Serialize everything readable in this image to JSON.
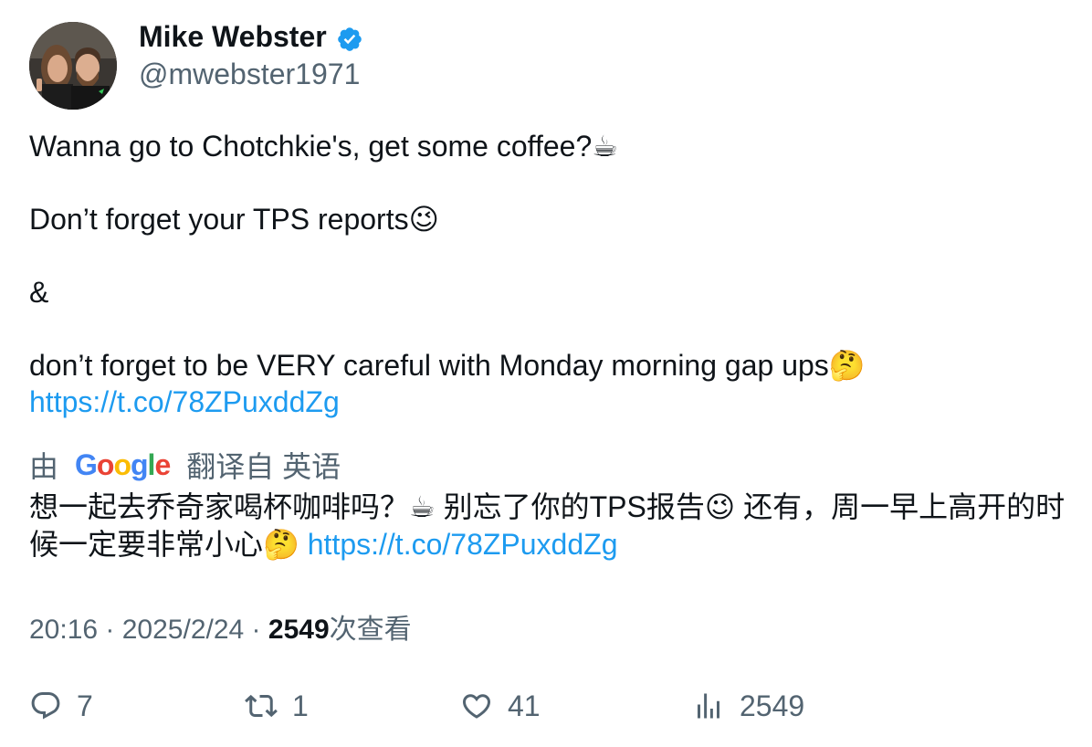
{
  "author": {
    "display_name": "Mike Webster",
    "handle": "@mwebster1971",
    "verified": true,
    "verified_color": "#1d9bf0",
    "avatar_icon": "profile-photo-avatar"
  },
  "tweet": {
    "line1": "Wanna go to Chotchkie's, get some coffee?☕",
    "line2": "Don’t forget your TPS reports😉",
    "line3": "&",
    "line4": "don’t forget to be VERY careful with Monday morning gap ups🤔",
    "link": "https://t.co/78ZPuxddZg"
  },
  "translation": {
    "prefix": "由",
    "provider": "Google",
    "suffix": "翻译自 英语",
    "text": "想一起去乔奇家喝杯咖啡吗？☕ 别忘了你的TPS报告😉 还有，周一早上高开的时候一定要非常小心🤔 ",
    "link": "https://t.co/78ZPuxddZg"
  },
  "meta": {
    "time": "20:16",
    "separator": " · ",
    "date": "2025/2/24",
    "views_count": "2549",
    "views_label": "次查看"
  },
  "actions": {
    "reply": {
      "count": "7",
      "icon": "reply-icon"
    },
    "retweet": {
      "count": "1",
      "icon": "retweet-icon"
    },
    "like": {
      "count": "41",
      "icon": "heart-icon"
    },
    "views": {
      "count": "2549",
      "icon": "analytics-icon"
    }
  },
  "colors": {
    "text_primary": "#0f1419",
    "text_secondary": "#536471",
    "link": "#1d9bf0"
  }
}
